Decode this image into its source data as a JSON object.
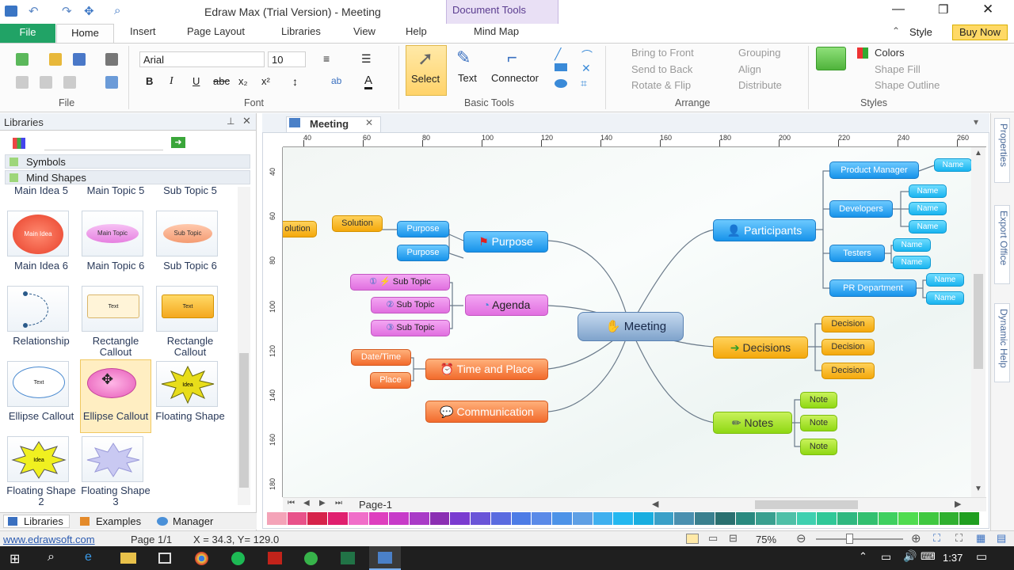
{
  "title": "Edraw Max (Trial Version) - Meeting",
  "context_tab": "Document Tools",
  "tabs": [
    "File",
    "Home",
    "Insert",
    "Page Layout",
    "Libraries",
    "View",
    "Help",
    "Mind Map"
  ],
  "top_right": {
    "style": "Style",
    "buy": "Buy Now"
  },
  "ribbon": {
    "font_name": "Arial",
    "font_size": "10",
    "groups": {
      "file": "File",
      "font": "Font",
      "basic": "Basic Tools",
      "arrange": "Arrange",
      "styles": "Styles"
    },
    "basic_tools": {
      "select": "Select",
      "text": "Text",
      "connector": "Connector"
    },
    "arrange": {
      "bring_front": "Bring to Front",
      "send_back": "Send to Back",
      "rotate": "Rotate & Flip",
      "grouping": "Grouping",
      "align": "Align",
      "distribute": "Distribute"
    },
    "styles": {
      "colors": "Colors",
      "fill": "Shape Fill",
      "outline": "Shape Outline"
    }
  },
  "libraries": {
    "title": "Libraries",
    "sections": [
      "Symbols",
      "Mind Shapes"
    ],
    "header_row": [
      "Main Idea 5",
      "Main Topic 5",
      "Sub Topic 5"
    ],
    "items": [
      {
        "label": "Main Idea 6",
        "inner": "Main Idea"
      },
      {
        "label": "Main Topic 6",
        "inner": "Main Topic"
      },
      {
        "label": "Sub Topic 6",
        "inner": "Sub Topic"
      },
      {
        "label": "Relationship",
        "inner": ""
      },
      {
        "label": "Rectangle Callout",
        "inner": "Text"
      },
      {
        "label": "Rectangle Callout",
        "inner": "Text"
      },
      {
        "label": "Ellipse Callout",
        "inner": "Text"
      },
      {
        "label": "Ellipse Callout",
        "inner": ""
      },
      {
        "label": "Floating Shape",
        "inner": "Idea"
      },
      {
        "label": "Floating Shape 2",
        "inner": "Idea"
      },
      {
        "label": "Floating Shape 3",
        "inner": ""
      }
    ],
    "bottom_tabs": [
      "Libraries",
      "Examples",
      "Manager"
    ]
  },
  "document": {
    "tab": "Meeting",
    "page_tab": "Page-1"
  },
  "ruler_h": [
    "40",
    "60",
    "80",
    "100",
    "120",
    "140",
    "160",
    "180",
    "200",
    "220",
    "240",
    "260"
  ],
  "ruler_v": [
    "40",
    "60",
    "80",
    "100",
    "120",
    "140",
    "160",
    "180"
  ],
  "mindmap": {
    "center": "Meeting",
    "purpose": "Purpose",
    "purpose_children": [
      "Purpose",
      "Purpose"
    ],
    "solution": "Solution",
    "solution_left": "olution",
    "agenda": "Agenda",
    "agenda_children": [
      "Sub Topic",
      "Sub Topic",
      "Sub Topic"
    ],
    "time": "Time and Place",
    "time_children": [
      "Date/Time",
      "Place"
    ],
    "communication": "Communication",
    "participants": "Participants",
    "roles": [
      "Product Manager",
      "Developers",
      "Testers",
      "PR Department"
    ],
    "name": "Name",
    "decisions": "Decisions",
    "decision_item": "Decision",
    "notes": "Notes",
    "note_item": "Note"
  },
  "right_panels": [
    "Properties",
    "Export Office",
    "Dynamic Help"
  ],
  "status": {
    "link": "www.edrawsoft.com",
    "page": "Page 1/1",
    "coords": "X = 34.3, Y= 129.0",
    "zoom": "75%"
  },
  "clock": "1:37",
  "palette": [
    "#f4a3b8",
    "#e8528a",
    "#d6234b",
    "#e01f6f",
    "#f06ec9",
    "#de3fbf",
    "#c73bc9",
    "#a93bc7",
    "#8b2fb3",
    "#7a3bd0",
    "#6a55d8",
    "#5a6be0",
    "#4d7ce6",
    "#5a8ae8",
    "#4d93e8",
    "#5fa0e5",
    "#3fb0ef",
    "#24b8f0",
    "#19aee0",
    "#3aa0c8",
    "#4a90b0",
    "#3a808f",
    "#2a7070",
    "#2a8a80",
    "#3aa090",
    "#4fc0a8",
    "#3fd0b0",
    "#30c898",
    "#2fb880",
    "#32c070",
    "#3fd060",
    "#50dc50",
    "#40c840",
    "#30b030",
    "#209f20"
  ]
}
